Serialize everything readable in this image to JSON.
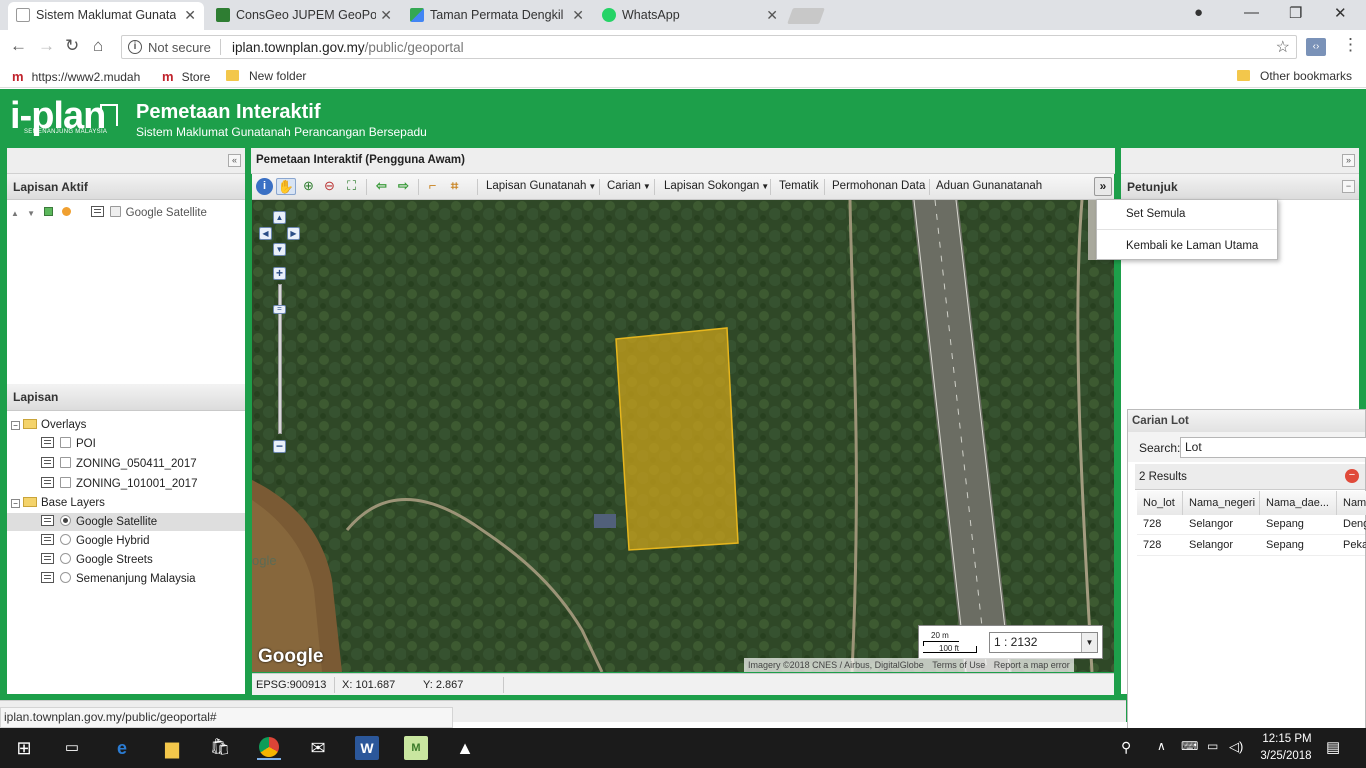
{
  "browser": {
    "tabs": [
      {
        "title": "Sistem Maklumat Gunatanah",
        "color": "#cfcfcf",
        "active": true
      },
      {
        "title": "ConsGeo JUPEM GeoPortal",
        "color": "#2e7d32",
        "active": false
      },
      {
        "title": "Taman Permata Dengkil",
        "color": "#34a853",
        "active": false
      },
      {
        "title": "WhatsApp",
        "color": "#25d366",
        "active": false
      }
    ],
    "not_secure": "Not secure",
    "url_host": "iplan.townplan.gov.my",
    "url_path": "/public/geoportal",
    "bookmarks": [
      {
        "label": "https://www2.mudah",
        "icon": "mudah-icon"
      },
      {
        "label": "Store",
        "icon": "mudah-icon"
      },
      {
        "label": "New folder",
        "icon": "folder-icon"
      }
    ],
    "other_bookmarks": "Other bookmarks",
    "status_url": "iplan.townplan.gov.my/public/geoportal#"
  },
  "app": {
    "logo_text": "i-plan",
    "logo_sub": "SEMENANJUNG MALAYSIA",
    "title": "Pemetaan Interaktif",
    "subtitle": "Sistem Maklumat Gunatanah Perancangan Bersepadu",
    "brand_color": "#1d9f4a"
  },
  "left": {
    "active_title": "Lapisan Aktif",
    "active_layer": "Google Satellite",
    "layers_title": "Lapisan",
    "overlays_label": "Overlays",
    "overlays": [
      "POI",
      "ZONING_050411_2017",
      "ZONING_101001_2017"
    ],
    "base_label": "Base Layers",
    "base_layers": [
      {
        "label": "Google Satellite",
        "selected": true
      },
      {
        "label": "Google Hybrid",
        "selected": false
      },
      {
        "label": "Google Streets",
        "selected": false
      },
      {
        "label": "Semenanjung Malaysia",
        "selected": false
      }
    ]
  },
  "center": {
    "title": "Pemetaan Interaktif (Pengguna Awam)",
    "menus": [
      "Lapisan Gunatanah",
      "Carian",
      "Lapisan Sokongan",
      "Tematik",
      "Permohonan Data",
      "Aduan Gunanatanah"
    ],
    "dropdown_items": [
      "Set Semula",
      "Kembali ke Laman Utama"
    ],
    "google_label": "Google",
    "attribution": "Imagery ©2018 CNES / Airbus, DigitalGlobe",
    "terms": "Terms of Use",
    "report": "Report a map error",
    "scale_m": "20 m",
    "scale_ft": "100 ft",
    "scale_value": "1 : 2132",
    "epsg": "EPSG:900913",
    "x_coord": "X: 101.687",
    "y_coord": "Y: 2.867",
    "parcel_color": "#c9a21b"
  },
  "right": {
    "title": "Petunjuk",
    "search_title": "Carian Lot",
    "search_label": "Search:",
    "search_value": "Lot",
    "results": "2 Results",
    "columns": [
      "No_lot",
      "Nama_negeri",
      "Nama_dae...",
      "Nam"
    ],
    "rows": [
      [
        "728",
        "Selangor",
        "Sepang",
        "Deng"
      ],
      [
        "728",
        "Selangor",
        "Sepang",
        "Peka"
      ]
    ]
  },
  "taskbar": {
    "time": "12:15 PM",
    "date": "3/25/2018"
  }
}
